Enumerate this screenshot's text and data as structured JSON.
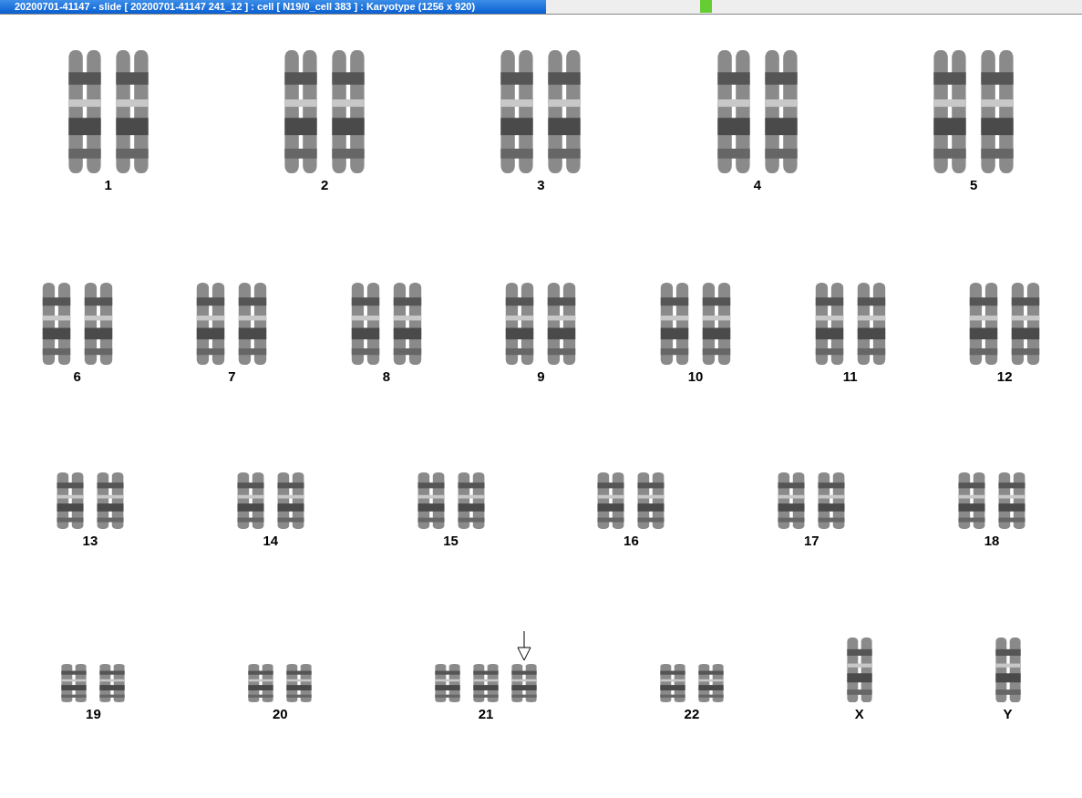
{
  "window": {
    "title": "20200701-41147 - slide [ 20200701-41147 241_12 ] : cell [ N19/0_cell 383 ] : Karyotype  (1256 x 920)"
  },
  "rows": [
    {
      "pairs": [
        {
          "label": "1",
          "chromosomes": [
            {
              "marked": false
            },
            {
              "marked": false
            }
          ]
        },
        {
          "label": "2",
          "chromosomes": [
            {
              "marked": false
            },
            {
              "marked": false
            }
          ]
        },
        {
          "label": "3",
          "chromosomes": [
            {
              "marked": false
            },
            {
              "marked": false
            }
          ]
        },
        {
          "label": "4",
          "chromosomes": [
            {
              "marked": false
            },
            {
              "marked": false
            }
          ]
        },
        {
          "label": "5",
          "chromosomes": [
            {
              "marked": false
            },
            {
              "marked": false
            }
          ]
        }
      ]
    },
    {
      "pairs": [
        {
          "label": "6",
          "chromosomes": [
            {
              "marked": false
            },
            {
              "marked": false
            }
          ]
        },
        {
          "label": "7",
          "chromosomes": [
            {
              "marked": false
            },
            {
              "marked": false
            }
          ]
        },
        {
          "label": "8",
          "chromosomes": [
            {
              "marked": false
            },
            {
              "marked": false
            }
          ]
        },
        {
          "label": "9",
          "chromosomes": [
            {
              "marked": false
            },
            {
              "marked": false
            }
          ]
        },
        {
          "label": "10",
          "chromosomes": [
            {
              "marked": false
            },
            {
              "marked": false
            }
          ]
        },
        {
          "label": "11",
          "chromosomes": [
            {
              "marked": false
            },
            {
              "marked": false
            }
          ]
        },
        {
          "label": "12",
          "chromosomes": [
            {
              "marked": false
            },
            {
              "marked": false
            }
          ]
        }
      ]
    },
    {
      "pairs": [
        {
          "label": "13",
          "chromosomes": [
            {
              "marked": false
            },
            {
              "marked": false
            }
          ]
        },
        {
          "label": "14",
          "chromosomes": [
            {
              "marked": false
            },
            {
              "marked": false
            }
          ]
        },
        {
          "label": "15",
          "chromosomes": [
            {
              "marked": false
            },
            {
              "marked": false
            }
          ]
        },
        {
          "label": "16",
          "chromosomes": [
            {
              "marked": false
            },
            {
              "marked": false
            }
          ]
        },
        {
          "label": "17",
          "chromosomes": [
            {
              "marked": false
            },
            {
              "marked": false
            }
          ]
        },
        {
          "label": "18",
          "chromosomes": [
            {
              "marked": false
            },
            {
              "marked": false
            }
          ]
        }
      ]
    },
    {
      "pairs": [
        {
          "label": "19",
          "chromosomes": [
            {
              "marked": false
            },
            {
              "marked": false
            }
          ]
        },
        {
          "label": "20",
          "chromosomes": [
            {
              "marked": false
            },
            {
              "marked": false
            }
          ]
        },
        {
          "label": "21",
          "chromosomes": [
            {
              "marked": false
            },
            {
              "marked": false
            },
            {
              "marked": true
            }
          ]
        },
        {
          "label": "22",
          "chromosomes": [
            {
              "marked": false
            },
            {
              "marked": false
            }
          ]
        },
        {
          "label": "X",
          "chromosomes": [
            {
              "marked": false
            }
          ]
        },
        {
          "label": "Y",
          "chromosomes": [
            {
              "marked": false
            }
          ]
        }
      ]
    }
  ]
}
